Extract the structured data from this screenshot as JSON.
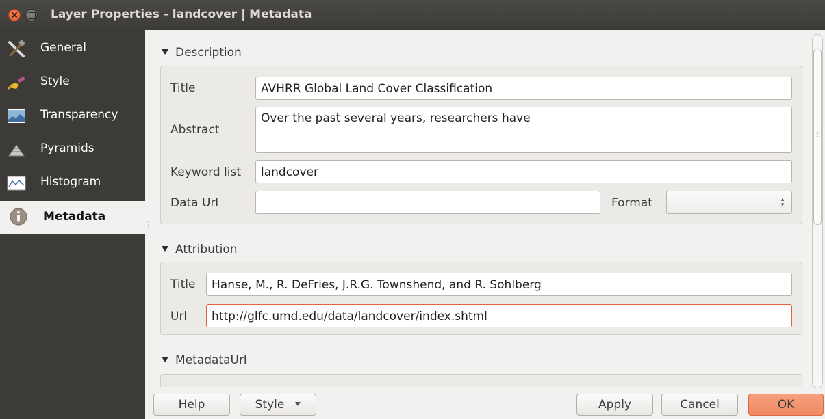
{
  "window": {
    "title": "Layer Properties - landcover | Metadata"
  },
  "sidebar": {
    "items": [
      {
        "label": "General",
        "icon": "tools-icon"
      },
      {
        "label": "Style",
        "icon": "brush-icon"
      },
      {
        "label": "Transparency",
        "icon": "transparency-icon"
      },
      {
        "label": "Pyramids",
        "icon": "pyramids-icon"
      },
      {
        "label": "Histogram",
        "icon": "histogram-icon"
      },
      {
        "label": "Metadata",
        "icon": "info-icon",
        "active": true
      }
    ]
  },
  "description": {
    "header": "Description",
    "title_label": "Title",
    "title_value": "AVHRR Global Land Cover Classification",
    "abstract_label": "Abstract",
    "abstract_value": "Over the past several years, researchers have",
    "keywords_label": "Keyword list",
    "keywords_value": "landcover",
    "dataurl_label": "Data Url",
    "dataurl_value": "",
    "format_label": "Format",
    "format_value": ""
  },
  "attribution": {
    "header": "Attribution",
    "title_label": "Title",
    "title_value": "Hanse, M., R. DeFries, J.R.G. Townshend, and R. Sohlberg",
    "url_label": "Url",
    "url_value": "http://glfc.umd.edu/data/landcover/index.shtml"
  },
  "metadataurl": {
    "header": "MetadataUrl"
  },
  "buttons": {
    "help": "Help",
    "style": "Style",
    "apply": "Apply",
    "cancel": "Cancel",
    "ok": "OK"
  },
  "colors": {
    "sidebar_bg": "#3c3b37",
    "accent": "#ef8a62",
    "focus_border": "#e0653a"
  }
}
